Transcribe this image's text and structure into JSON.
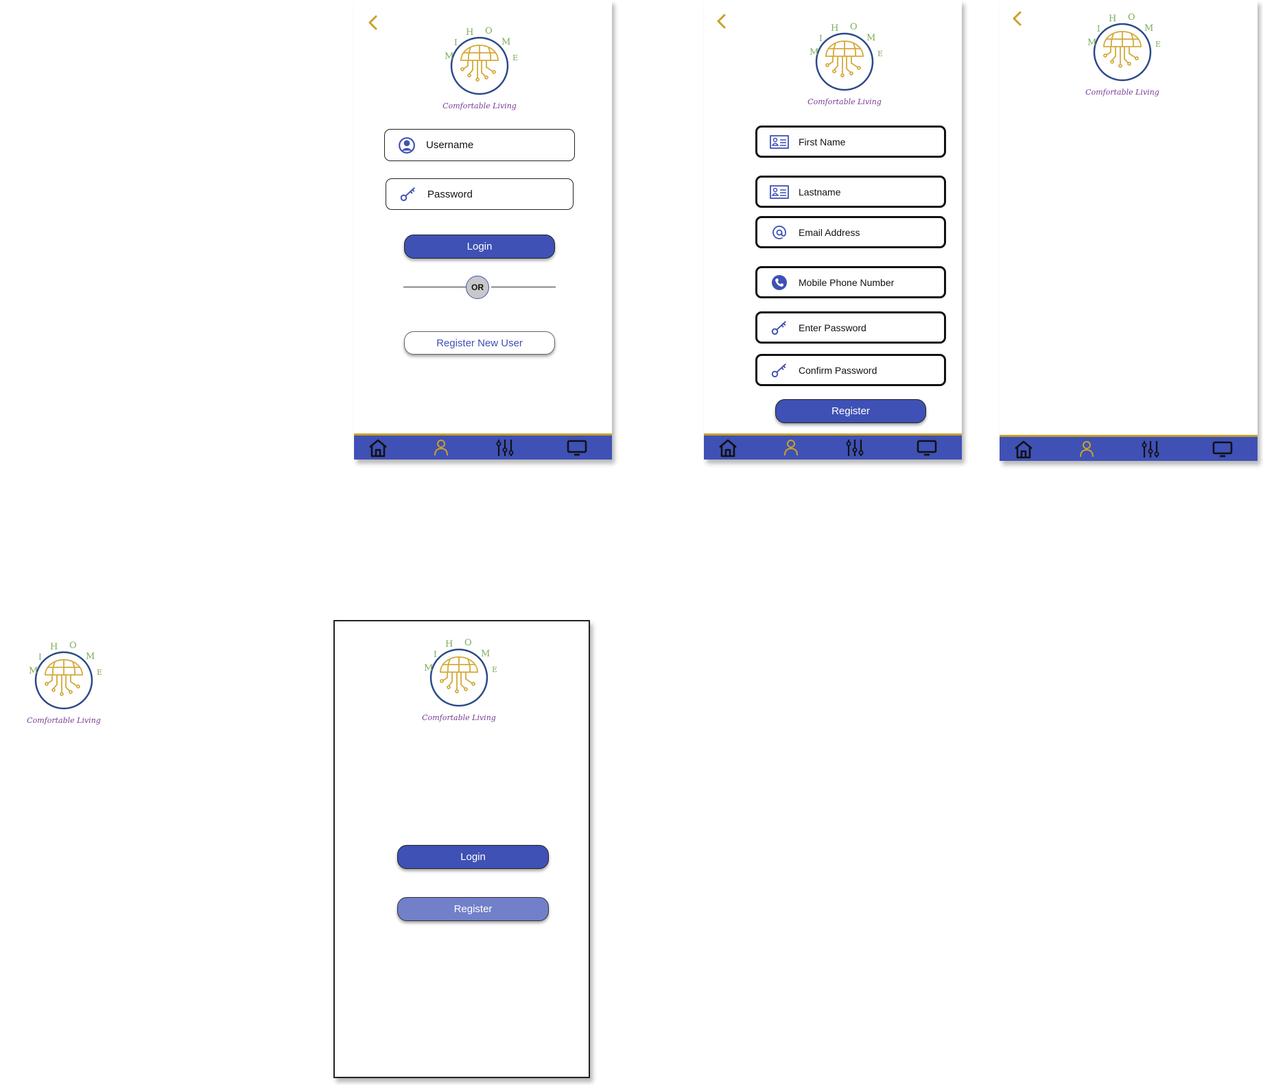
{
  "brand": {
    "name_letters": [
      "M",
      "I",
      "H",
      "O",
      "M",
      "E"
    ],
    "tagline": "Comfortable Living"
  },
  "colors": {
    "primary": "#3f51b5",
    "gold": "#c9a227",
    "green": "#7cae5a",
    "purple": "#7b3a96",
    "navy": "#2c4a8a"
  },
  "login_screen": {
    "username_label": "Username",
    "password_label": "Password",
    "login_label": "Login",
    "or_label": "OR",
    "register_new_user_label": "Register New User"
  },
  "register_screen": {
    "fields": [
      {
        "label": "First Name",
        "icon": "id-card-icon"
      },
      {
        "label": "Lastname",
        "icon": "id-card-icon"
      },
      {
        "label": "Email Address",
        "icon": "at-sign-icon"
      },
      {
        "label": "Mobile Phone Number",
        "icon": "phone-icon"
      },
      {
        "label": "Enter Password",
        "icon": "key-icon"
      },
      {
        "label": "Confirm Password",
        "icon": "key-icon"
      }
    ],
    "register_label": "Register"
  },
  "welcome_screen": {
    "login_label": "Login",
    "register_label": "Register"
  },
  "navbar": {
    "items": [
      "home-icon",
      "user-icon",
      "sliders-icon",
      "monitor-icon"
    ]
  }
}
